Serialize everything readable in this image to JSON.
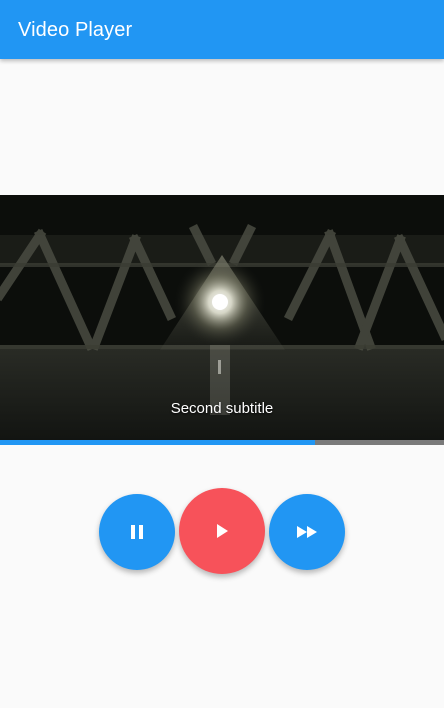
{
  "app_bar": {
    "title": "Video Player",
    "color": "#2196f3"
  },
  "video": {
    "subtitle": "Second subtitle",
    "progress": 0.71,
    "progress_color": "#2196f3"
  },
  "controls": {
    "buttons": [
      {
        "icon": "pause-icon",
        "color": "#2196f3"
      },
      {
        "icon": "play-icon",
        "color": "#f7525a"
      },
      {
        "icon": "fast-forward-icon",
        "color": "#2196f3"
      }
    ]
  }
}
